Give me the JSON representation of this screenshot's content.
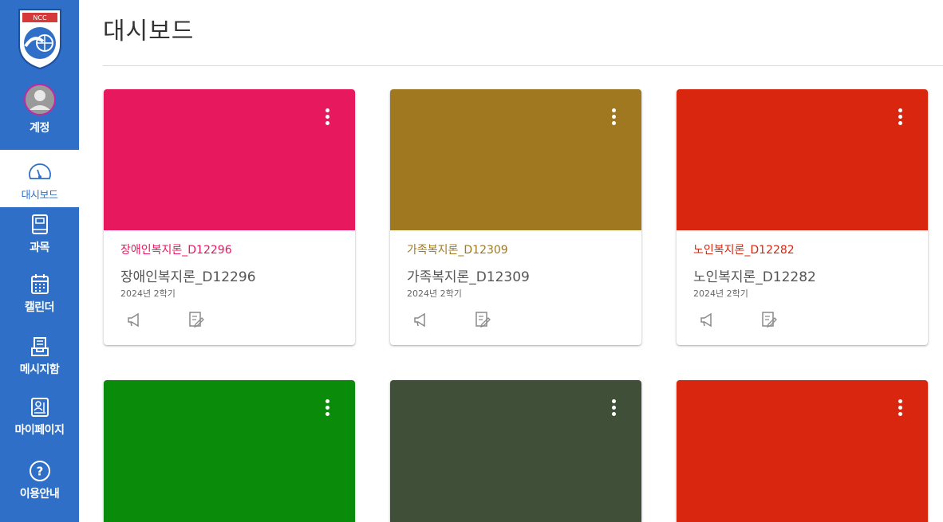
{
  "sidebar": {
    "logo_text": "NCC",
    "items": [
      {
        "label": "계정",
        "icon": "account-avatar"
      },
      {
        "label": "대시보드",
        "icon": "dashboard-gauge-icon"
      },
      {
        "label": "과목",
        "icon": "courses-book-icon"
      },
      {
        "label": "캘린더",
        "icon": "calendar-icon"
      },
      {
        "label": "메시지함",
        "icon": "inbox-icon"
      },
      {
        "label": "마이페이지",
        "icon": "mypage-icon"
      },
      {
        "label": "이용안내",
        "icon": "help-icon"
      }
    ]
  },
  "header": {
    "title": "대시보드"
  },
  "cards": [
    {
      "title": "장애인복지론_D12296",
      "subtitle": "장애인복지론_D12296",
      "term": "2024년 2학기",
      "color": "#e8185f"
    },
    {
      "title": "가족복지론_D12309",
      "subtitle": "가족복지론_D12309",
      "term": "2024년 2학기",
      "color": "#a07820"
    },
    {
      "title": "노인복지론_D12282",
      "subtitle": "노인복지론_D12282",
      "term": "2024년 2학기",
      "color": "#d9260f"
    },
    {
      "title": "",
      "subtitle": "",
      "term": "",
      "color": "#0a8c0a"
    },
    {
      "title": "",
      "subtitle": "",
      "term": "",
      "color": "#3f4f38"
    },
    {
      "title": "",
      "subtitle": "",
      "term": "",
      "color": "#d9260f"
    }
  ],
  "colors": {
    "sidebar": "#2f6fc7",
    "active_bg": "#ffffff"
  }
}
